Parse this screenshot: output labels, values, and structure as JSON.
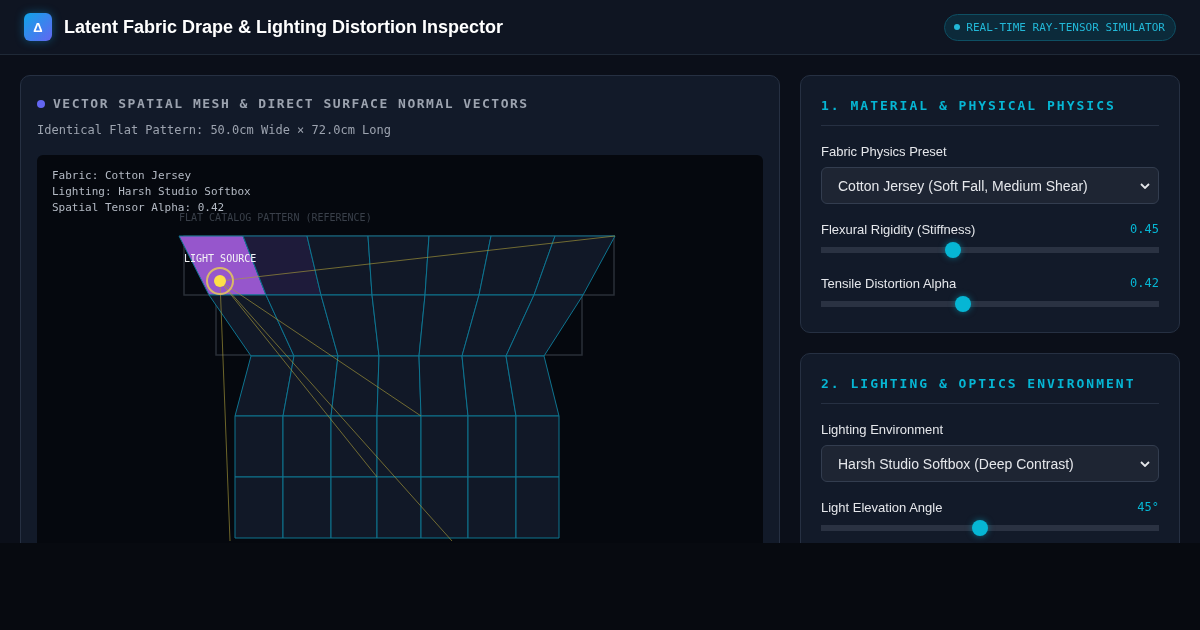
{
  "header": {
    "logo": "Δ",
    "title": "Latent Fabric Drape & Lighting Distortion Inspector",
    "badge": "REAL-TIME RAY-TENSOR SIMULATOR"
  },
  "viewer": {
    "title": "VECTOR SPATIAL MESH & DIRECT SURFACE NORMAL VECTORS",
    "subtitle": "Identical Flat Pattern: 50.0cm Wide × 72.0cm Long",
    "overlay": [
      "Fabric: Cotton Jersey",
      "Lighting: Harsh Studio Softbox",
      "Spatial Tensor Alpha: 0.42"
    ],
    "reference_label": "FLAT CATALOG PATTERN (REFERENCE)",
    "light_label": "LIGHT SOURCE"
  },
  "panels": [
    {
      "title": "1. MATERIAL & PHYSICAL PHYSICS",
      "select": {
        "label": "Fabric Physics Preset",
        "value": "Cotton Jersey (Soft Fall, Medium Shear)"
      },
      "sliders": [
        {
          "label": "Flexural Rigidity (Stiffness)",
          "reading": "0.45",
          "level": 0.39
        },
        {
          "label": "Tensile Distortion Alpha",
          "reading": "0.42",
          "level": 0.42
        }
      ]
    },
    {
      "title": "2. LIGHTING & OPTICS ENVIRONMENT",
      "select": {
        "label": "Lighting Environment",
        "value": "Harsh Studio Softbox (Deep Contrast)"
      },
      "sliders": [
        {
          "label": "Light Elevation Angle",
          "reading": "45°",
          "level": 0.47
        }
      ]
    }
  ]
}
